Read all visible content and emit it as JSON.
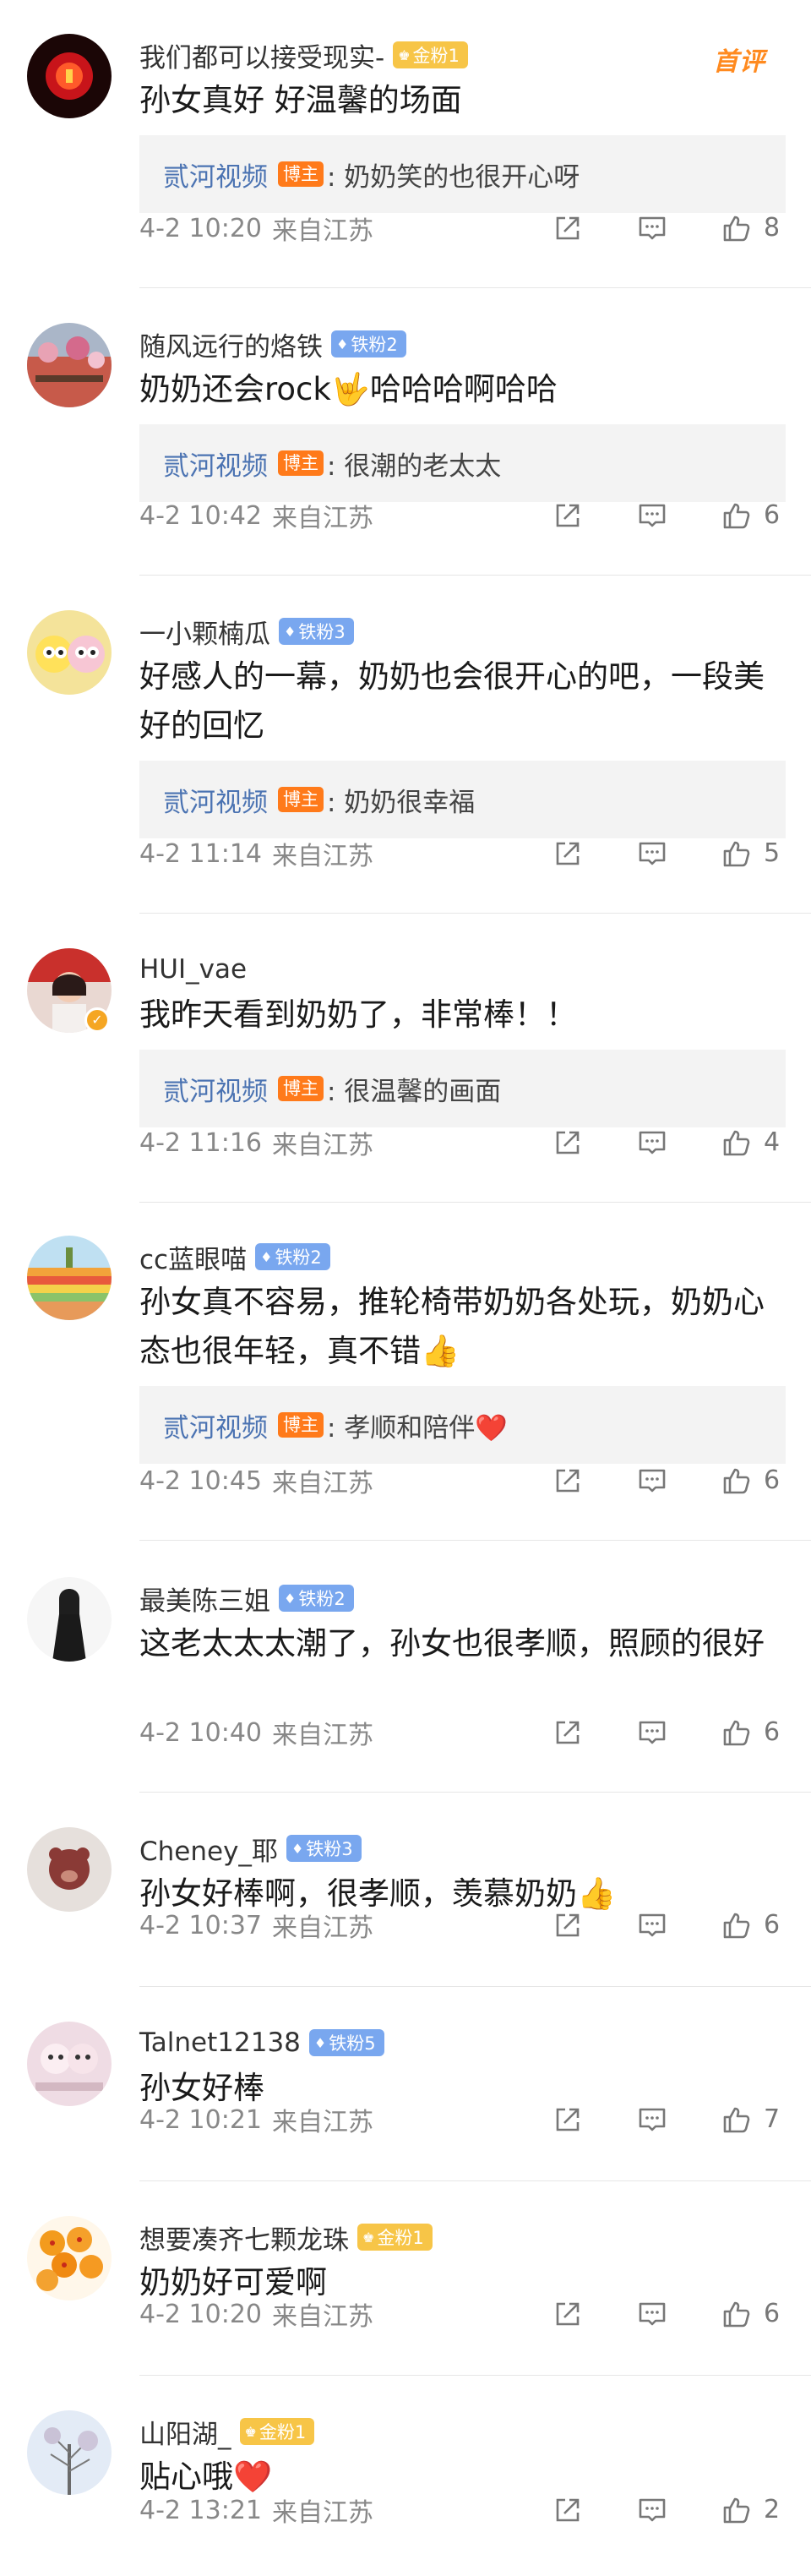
{
  "hot_tag": "首评",
  "location": "来自江苏",
  "comments": [
    {
      "username": "我们都可以接受现实-",
      "badge": {
        "type": "gold",
        "label": "金粉1"
      },
      "text": "孙女真好 好温馨的场面",
      "reply": {
        "author": "贰河视频",
        "role": "博主",
        "text": ": 奶奶笑的也很开心呀"
      },
      "time": "4-2 10:20",
      "likes": "8",
      "avatar": "red-lantern"
    },
    {
      "username": "随风远行的烙铁",
      "badge": {
        "type": "iron",
        "label": "铁粉2"
      },
      "text": "奶奶还会rock🤟哈哈哈啊哈哈",
      "reply": {
        "author": "贰河视频",
        "role": "博主",
        "text": ": 很潮的老太太"
      },
      "time": "4-2 10:42",
      "likes": "6",
      "avatar": "flowers-building"
    },
    {
      "username": "一小颗楠瓜",
      "badge": {
        "type": "iron",
        "label": "铁粉3"
      },
      "text": "好感人的一幕，奶奶也会很开心的吧，一段美好的回忆",
      "reply": {
        "author": "贰河视频",
        "role": "博主",
        "text": ": 奶奶很幸福"
      },
      "time": "4-2 11:14",
      "likes": "5",
      "avatar": "cartoon-couple"
    },
    {
      "username": "HUI_vae",
      "badge": null,
      "verified": true,
      "text": "我昨天看到奶奶了，非常棒！！",
      "reply": {
        "author": "贰河视频",
        "role": "博主",
        "text": ": 很温馨的画面"
      },
      "time": "4-2 11:16",
      "likes": "4",
      "avatar": "girl-red"
    },
    {
      "username": "cc蓝眼喵",
      "badge": {
        "type": "iron",
        "label": "铁粉2"
      },
      "text": "孙女真不容易，推轮椅带奶奶各处玩，奶奶心态也很年轻，真不错👍",
      "reply": {
        "author": "贰河视频",
        "role": "博主",
        "text": ": 孝顺和陪伴❤️"
      },
      "time": "4-2 10:45",
      "likes": "6",
      "avatar": "rainbow-stripes"
    },
    {
      "username": "最美陈三姐",
      "badge": {
        "type": "iron",
        "label": "铁粉2"
      },
      "text": "这老太太太潮了，孙女也很孝顺，照顾的很好",
      "reply": null,
      "time": "4-2 10:40",
      "likes": "6",
      "avatar": "woman-dress"
    },
    {
      "username": "Cheney_耶",
      "badge": {
        "type": "iron",
        "label": "铁粉3"
      },
      "text": "孙女好棒啊，很孝顺，羡慕奶奶👍",
      "reply": null,
      "time": "4-2 10:37",
      "likes": "6",
      "avatar": "teddy-cup"
    },
    {
      "username": "Talnet12138",
      "badge": {
        "type": "iron",
        "label": "铁粉5"
      },
      "text": "孙女好棒",
      "reply": null,
      "time": "4-2 10:21",
      "likes": "7",
      "avatar": "pink-cats"
    },
    {
      "username": "想要凑齐七颗龙珠",
      "badge": {
        "type": "gold",
        "label": "金粉1"
      },
      "text": "奶奶好可爱啊",
      "reply": null,
      "time": "4-2 10:20",
      "likes": "6",
      "avatar": "dragon-balls"
    },
    {
      "username": "山阳湖_",
      "badge": {
        "type": "gold",
        "label": "金粉1"
      },
      "text": "贴心哦❤️",
      "reply": null,
      "time": "4-2 13:21",
      "likes": "2",
      "avatar": "winter-tree"
    }
  ],
  "colors": {
    "reply_author": "#4b73b2",
    "op_badge": "#ff7a1a",
    "gold_badge": "#f7c547",
    "iron_badge": "#79a7ef",
    "hot_tag": "#ff8a1f"
  }
}
